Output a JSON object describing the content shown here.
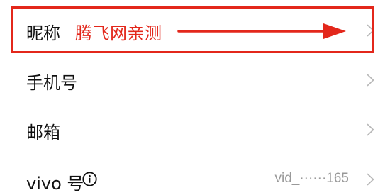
{
  "annotation": {
    "text": "腾飞网亲测",
    "color": "#e3271b"
  },
  "rows": [
    {
      "label": "昵称",
      "value": ""
    },
    {
      "label": "手机号",
      "value": ""
    },
    {
      "label": "邮箱",
      "value": ""
    },
    {
      "label": "vivo 号",
      "value": "vid_······165"
    }
  ],
  "icons": {
    "chevron": "chevron-right-icon",
    "info": "info-circle-icon",
    "arrow": "arrow-right-icon"
  }
}
